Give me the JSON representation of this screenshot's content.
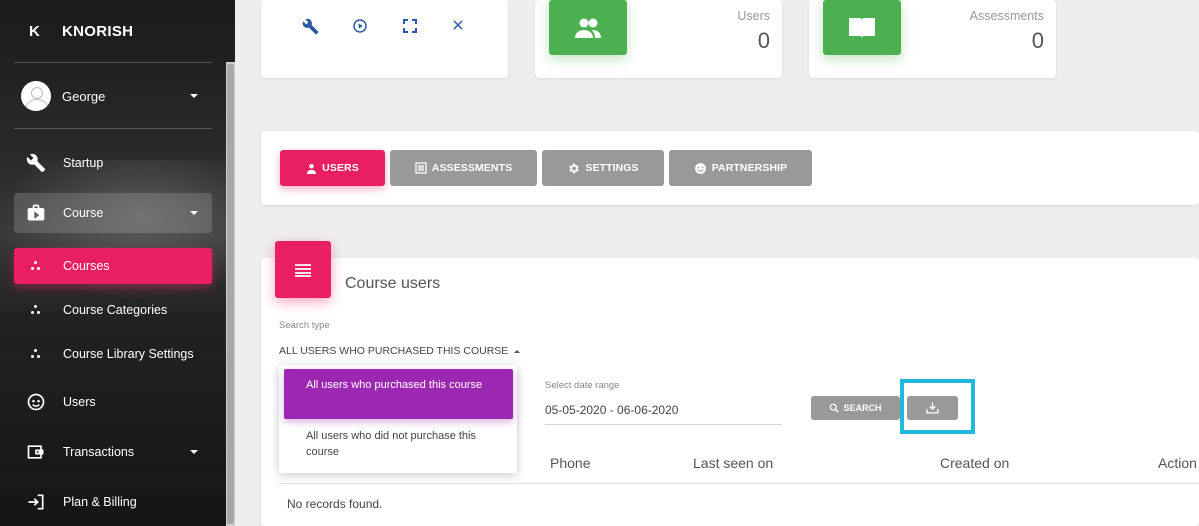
{
  "brand": {
    "mini": "K",
    "name": "KNORISH"
  },
  "user": {
    "name": "George"
  },
  "nav": {
    "startup": "Startup",
    "course": "Course",
    "courses": "Courses",
    "course_categories": "Course Categories",
    "course_library_settings": "Course Library Settings",
    "users": "Users",
    "transactions": "Transactions",
    "plan_billing": "Plan & Billing"
  },
  "stats": {
    "users": {
      "label": "Users",
      "value": "0"
    },
    "assessments": {
      "label": "Assessments",
      "value": "0"
    }
  },
  "tabs": {
    "users": "USERS",
    "assessments": "ASSESSMENTS",
    "settings": "SETTINGS",
    "partnership": "PARTNERSHIP"
  },
  "course_users": {
    "title": "Course users",
    "search_type_label": "Search type",
    "search_type_value": "ALL USERS WHO PURCHASED THIS COURSE",
    "options": [
      "All users who purchased this course",
      "All users who did not purchase this course"
    ],
    "date_range_label": "Select date range",
    "date_range_value": "05-05-2020 - 06-06-2020",
    "search_button": "SEARCH",
    "columns": [
      "Phone",
      "Last seen on",
      "Created on",
      "Action"
    ],
    "empty_message": "No records found."
  },
  "colors": {
    "primary": "#e91e63",
    "success": "#4caf50",
    "purple": "#9c27b0",
    "highlight": "#22b7dc"
  }
}
